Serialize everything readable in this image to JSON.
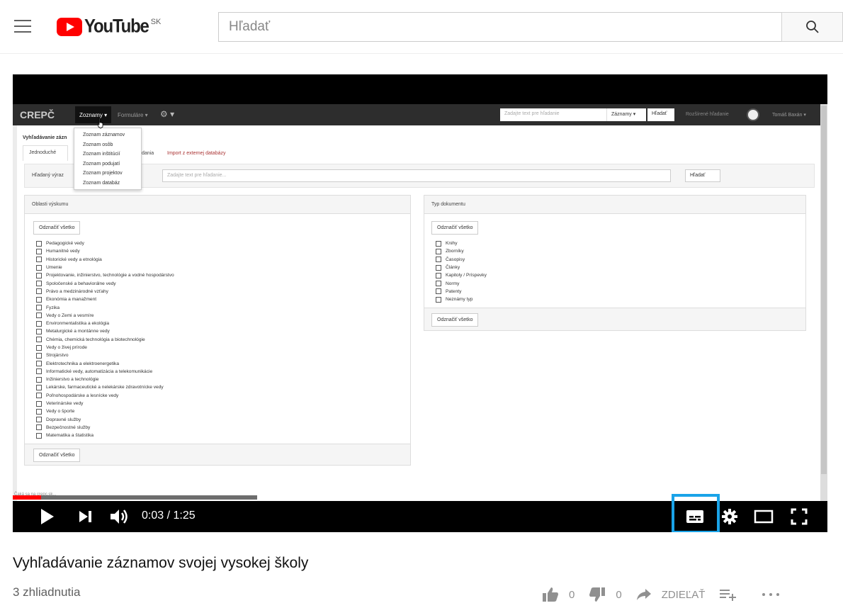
{
  "header": {
    "logo_word": "YouTube",
    "logo_country": "SK",
    "search_placeholder": "Hľadať"
  },
  "video_content": {
    "brand": "CREPČ",
    "menu_active": "Zoznamy ▾",
    "menu_forms": "Formuláre ▾",
    "menu_tools": "⚙ ▾",
    "nav_search_placeholder": "Zadajte text pre hľadanie",
    "nav_search_select": "Záznamy ▾",
    "nav_search_button": "Hľadať",
    "nav_advanced": "Rozšírené hľadanie",
    "nav_user": "Tomáš Baxán ▾",
    "page_title": "Vyhľadávanie zázn",
    "tab_simple": "Jednoduché",
    "tab_partial": "dania",
    "tab_import": "Import z externej databázy",
    "search_label": "Hľadaný výraz",
    "search_input_placeholder": "Zadajte text pre hľadanie...",
    "search_button": "Hľadať",
    "dropdown_items": [
      "Zoznam záznamov",
      "Zoznam osôb",
      "Zoznam inštitúcií",
      "Zoznam podujatí",
      "Zoznam projektov",
      "Zoznam databáz"
    ],
    "left_panel": {
      "title": "Oblasti výskumu",
      "button_label": "Odznačiť všetko",
      "items": [
        "Pedagogické vedy",
        "Humanitné vedy",
        "Historické vedy a etnológia",
        "Umenie",
        "Projektovanie, inžinierstvo, technológie a vodné hospodárstvo",
        "Spoločenské a behaviorálne vedy",
        "Právo a medzinárodné vzťahy",
        "Ekonómia a manažment",
        "Fyzika",
        "Vedy o Zemi a vesmíre",
        "Environmentalistika a ekológia",
        "Metalurgické a montánne vedy",
        "Chémia, chemická technológia a biotechnológie",
        "Vedy o živej prírode",
        "Strojárstvo",
        "Elektrotechnika a elektroenergetika",
        "Informatické vedy, automatizácia a telekomunikácie",
        "Inžinierstvo a technológie",
        "Lekárske, farmaceutické a nelekárske zdravotnícke vedy",
        "Poľnohospodárske a lesnícke vedy",
        "Veterinárske vedy",
        "Vedy o športe",
        "Dopravné služby",
        "Bezpečnostné služby",
        "Matematika a štatistika"
      ]
    },
    "right_panel": {
      "title": "Typ dokumentu",
      "button_label": "Odznačiť všetko",
      "items": [
        "Knihy",
        "Zborníky",
        "Časopisy",
        "Články",
        "Kapitoly / Príspevky",
        "Normy",
        "Patenty",
        "Neznámy typ"
      ]
    },
    "status_text": "Čaká sa na crepc.sk..."
  },
  "player": {
    "time": "0:03 / 1:25",
    "progress_played_fraction": 0.035,
    "progress_loaded_fraction": 0.3,
    "highlight_color": "#1aa3e8"
  },
  "video_info": {
    "title": "Vyhľadávanie záznamov svojej vysokej školy",
    "views": "3 zhliadnutia",
    "likes": "0",
    "dislikes": "0",
    "share_label": "ZDIEĽAŤ",
    "icons": [
      "thumb-up-icon",
      "thumb-down-icon",
      "share-icon",
      "add-to-playlist-icon",
      "more-icon"
    ]
  }
}
